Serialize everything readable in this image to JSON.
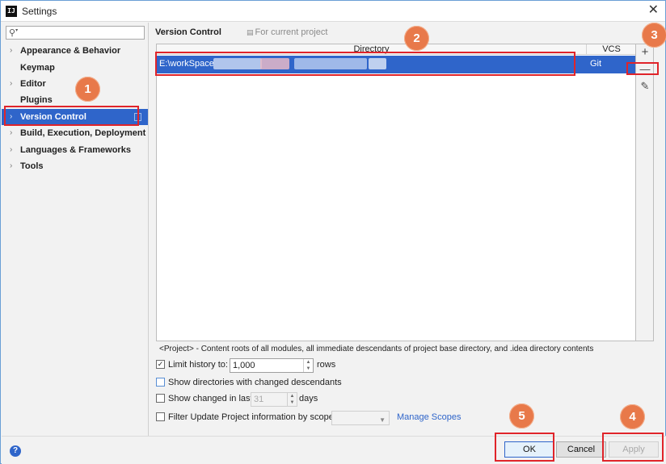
{
  "window": {
    "title": "Settings",
    "app_icon_text": "IJ"
  },
  "sidebar": {
    "search": {
      "value": "",
      "placeholder": ""
    },
    "items": [
      {
        "label": "Appearance & Behavior",
        "expandable": true
      },
      {
        "label": "Keymap",
        "expandable": false
      },
      {
        "label": "Editor",
        "expandable": true
      },
      {
        "label": "Plugins",
        "expandable": false
      },
      {
        "label": "Version Control",
        "expandable": true,
        "selected": true
      },
      {
        "label": "Build, Execution, Deployment",
        "expandable": true
      },
      {
        "label": "Languages & Frameworks",
        "expandable": true
      },
      {
        "label": "Tools",
        "expandable": true
      }
    ]
  },
  "main": {
    "title": "Version Control",
    "scope_note": "For current project",
    "table": {
      "headers": {
        "directory": "Directory",
        "vcs": "VCS"
      },
      "rows": [
        {
          "directory": "E:\\workSpace",
          "vcs": "Git"
        }
      ]
    },
    "toolbar": {
      "add": "+",
      "remove": "—",
      "edit": "✎"
    },
    "info": "<Project> - Content roots of all modules, all immediate descendants of project base directory, and .idea directory contents",
    "options": {
      "limit_history": {
        "label": "Limit history to:",
        "value": "1,000",
        "suffix": "rows",
        "checked": true
      },
      "show_directories": {
        "label": "Show directories with changed descendants",
        "checked": false
      },
      "show_changed": {
        "label": "Show changed in last",
        "value": "31",
        "suffix": "days",
        "checked": false
      },
      "filter_update": {
        "label": "Filter Update Project information by scope",
        "checked": false,
        "scope_value": ""
      },
      "manage_scopes": "Manage Scopes"
    }
  },
  "footer": {
    "help": "?",
    "ok": "OK",
    "cancel": "Cancel",
    "apply": "Apply"
  },
  "annotations": {
    "color": "#e0242a",
    "badge_color": "#e8794a",
    "badges": [
      "1",
      "2",
      "3",
      "4",
      "5"
    ]
  }
}
